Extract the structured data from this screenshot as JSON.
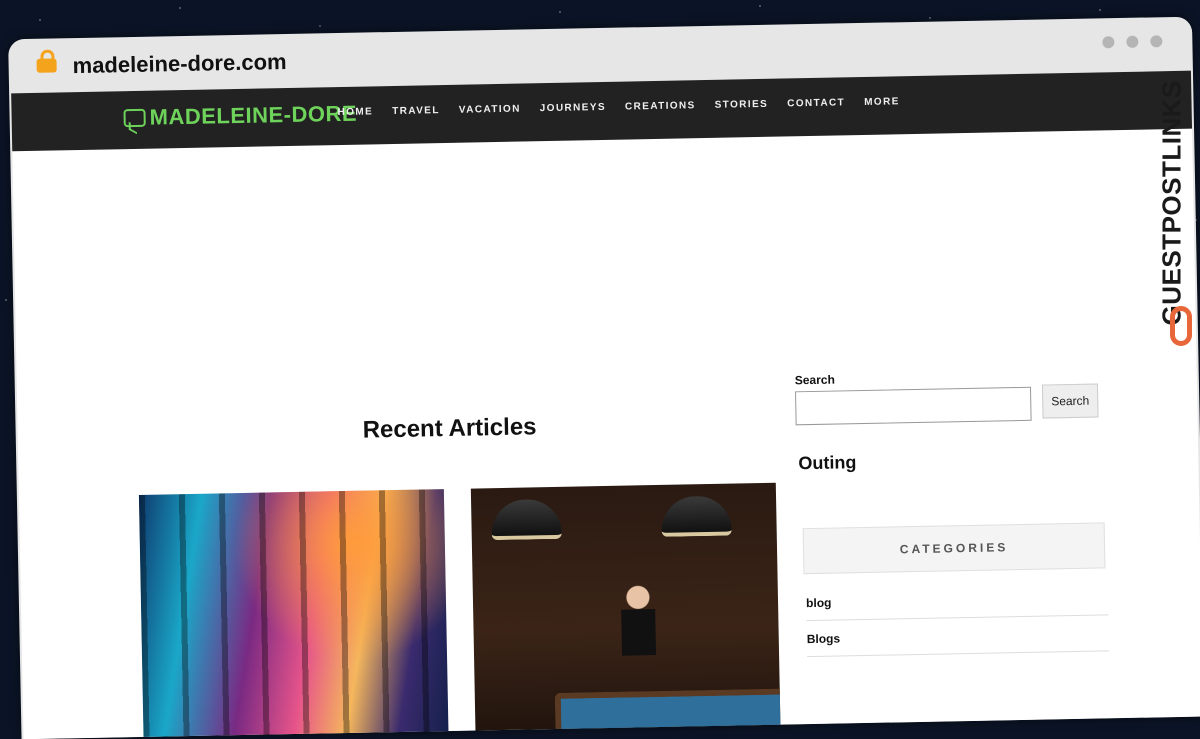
{
  "browser": {
    "url": "madeleine-dore.com"
  },
  "site": {
    "logo_text": "MADELEINE-DORE",
    "nav": [
      "HOME",
      "TRAVEL",
      "VACATION",
      "JOURNEYS",
      "CREATIONS",
      "STORIES",
      "CONTACT",
      "MORE"
    ]
  },
  "main": {
    "recent_title": "Recent Articles"
  },
  "sidebar": {
    "search_label": "Search",
    "search_button": "Search",
    "search_value": "",
    "widget_title": "Outing",
    "categories_title": "CATEGORIES",
    "categories": [
      "blog",
      "Blogs"
    ]
  },
  "watermark": {
    "text": "GUESTPOSTLINKS"
  },
  "colors": {
    "nav_bg": "#222222",
    "logo": "#6ed35a",
    "watermark_icon": "#e8673a"
  }
}
